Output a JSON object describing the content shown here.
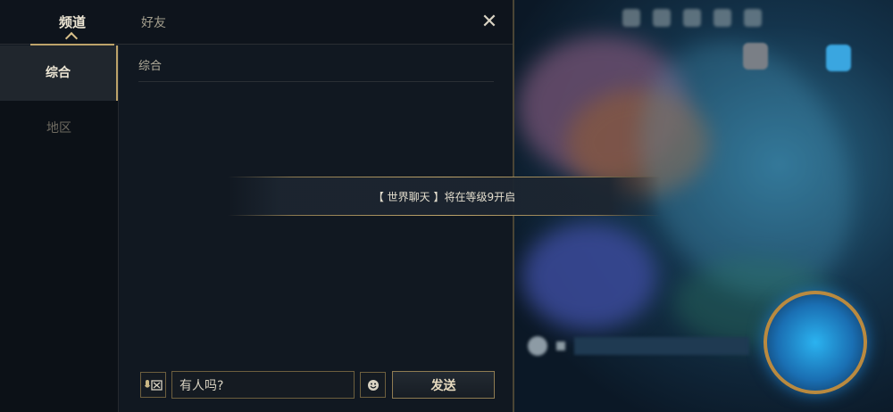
{
  "header": {
    "tab_channel": "频道",
    "tab_friends": "好友",
    "close_glyph": "✕"
  },
  "sidebar": {
    "items": [
      {
        "label": "综合",
        "active": true
      },
      {
        "label": "地区",
        "active": false
      }
    ]
  },
  "channel": {
    "title": "综合"
  },
  "notice": {
    "text": "【 世界聊天 】将在等级9开启"
  },
  "input_bar": {
    "message_value": "有人吗?",
    "send_label": "发送",
    "voice_icon": "voice-keyboard-icon",
    "emoji_icon": "emoji-icon"
  },
  "colors": {
    "accent_gold": "#bda36a",
    "panel_bg": "#111821",
    "play_blue": "#2bb3f0"
  }
}
